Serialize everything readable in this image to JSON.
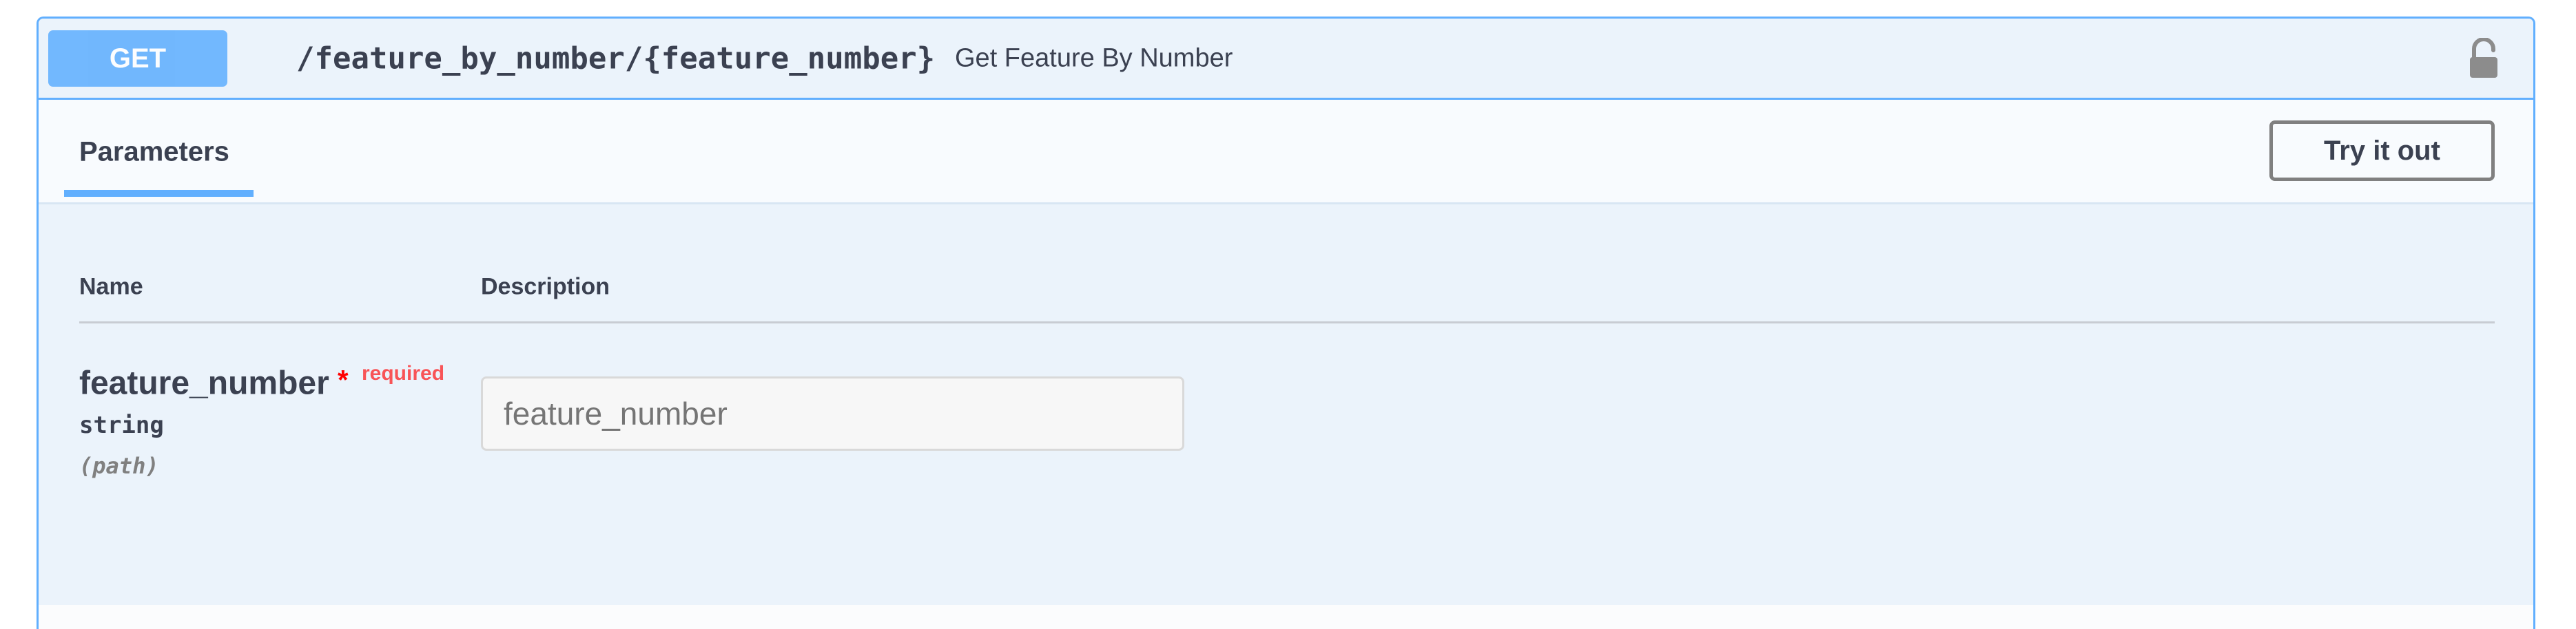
{
  "operation": {
    "method": "GET",
    "path": "/feature_by_number/{feature_number}",
    "summary": "Get Feature By Number",
    "lock_icon": "unlocked-padlock-icon"
  },
  "tabs": {
    "parameters_label": "Parameters",
    "try_it_out_label": "Try it out"
  },
  "parameters_table": {
    "name_header": "Name",
    "description_header": "Description",
    "rows": [
      {
        "name": "feature_number",
        "required_star": "*",
        "required_label": "required",
        "type": "string",
        "in": "(path)",
        "input_placeholder": "feature_number",
        "input_value": ""
      }
    ]
  },
  "colors": {
    "get_accent": "#61affe",
    "block_background": "#ebf3fb",
    "required_red": "#ff0000",
    "text": "#3b4151"
  }
}
